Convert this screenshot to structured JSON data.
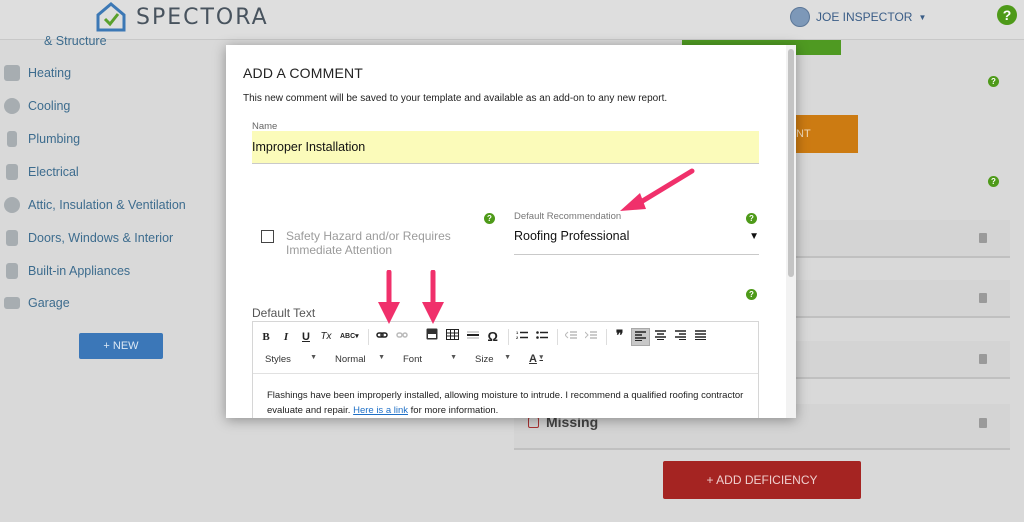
{
  "app": {
    "brand": "SPECTORA",
    "user_name": "JOE INSPECTOR",
    "help_label": "?"
  },
  "sidebar": {
    "items": [
      {
        "label": "& Structure",
        "icon": "structure-icon"
      },
      {
        "label": "Heating",
        "icon": "house-heating-icon"
      },
      {
        "label": "Cooling",
        "icon": "snowflake-icon"
      },
      {
        "label": "Plumbing",
        "icon": "pipe-icon"
      },
      {
        "label": "Electrical",
        "icon": "outlet-icon"
      },
      {
        "label": "Attic, Insulation & Ventilation",
        "icon": "fan-icon"
      },
      {
        "label": "Doors, Windows & Interior",
        "icon": "door-icon"
      },
      {
        "label": "Built-in Appliances",
        "icon": "appliance-icon"
      },
      {
        "label": "Garage",
        "icon": "garage-icon"
      }
    ],
    "new_button": "+ NEW"
  },
  "background": {
    "orange_button_text": "NT",
    "missing_label": "Missing",
    "add_deficiency": "+ ADD DEFICIENCY"
  },
  "modal": {
    "title": "ADD A COMMENT",
    "description": "This new comment will be saved to your template and available as an add-on to any new report.",
    "name_label": "Name",
    "name_value": "Improper Installation",
    "safety_label": "Safety Hazard and/or Requires Immediate Attention",
    "safety_checked": false,
    "recommendation_label": "Default Recommendation",
    "recommendation_value": "Roofing Professional",
    "default_text_label": "Default Text",
    "toolbar": {
      "bold": "B",
      "italic": "I",
      "underline": "U",
      "clear_format": "Tx",
      "spellcheck": "ABC",
      "link": "link-icon",
      "unlink": "unlink-icon",
      "youtube": "youtube-icon",
      "table": "table-icon",
      "hr": "horizontal-rule-icon",
      "omega": "Ω",
      "numbered_list": "numbered-list-icon",
      "bullet_list": "bullet-list-icon",
      "outdent": "outdent-icon",
      "indent": "indent-icon",
      "blockquote": "❞",
      "align_left": "align-left-icon",
      "align_center": "align-center-icon",
      "align_right": "align-right-icon",
      "justify": "justify-icon",
      "styles": "Styles",
      "format": "Normal",
      "font": "Font",
      "size": "Size",
      "text_color": "A"
    },
    "body_text_before": "Flashings have been improperly installed, allowing moisture to intrude. I recommend a qualified roofing contractor evaluate and repair.",
    "body_link_text": "Here is a link",
    "body_text_after": "for more information."
  },
  "colors": {
    "accent_green": "#4e9a19",
    "primary_blue": "#3b77b8",
    "warning_orange": "#cc7b12",
    "danger_red": "#a52422",
    "annotation_pink": "#f0306b",
    "name_highlight": "#fbfbba"
  }
}
